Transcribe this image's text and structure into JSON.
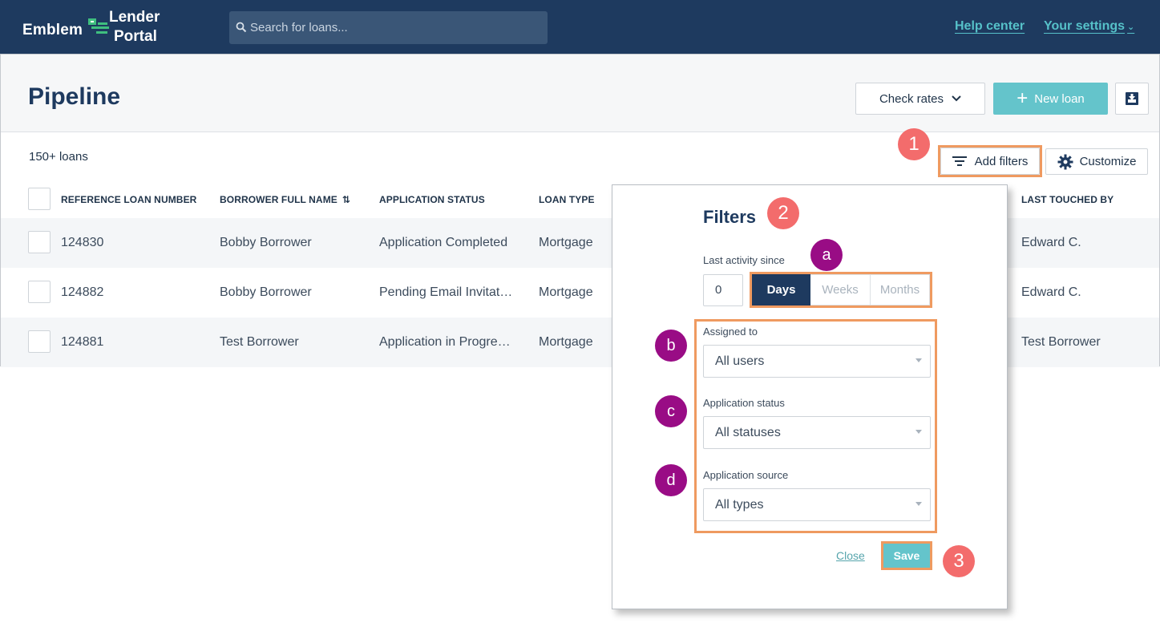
{
  "app": {
    "logo_word": "Emblem",
    "logo_line1": "Lender",
    "logo_line2": "Portal",
    "search_placeholder": "Search for loans...",
    "help_link": "Help center",
    "settings_link": "Your settings"
  },
  "page": {
    "title": "Pipeline",
    "check_rates_label": "Check rates",
    "new_loan_label": "New loan",
    "loan_count": "150+ loans",
    "add_filters_label": "Add filters",
    "customize_label": "Customize"
  },
  "table": {
    "headers": {
      "ref": "REFERENCE LOAN NUMBER",
      "borrower": "BORROWER FULL NAME",
      "status": "APPLICATION STATUS",
      "type": "LOAN TYPE",
      "touched": "LAST TOUCHED BY"
    },
    "rows": [
      {
        "ref": "124830",
        "borrower": "Bobby Borrower",
        "status": "Application Completed",
        "type": "Mortgage",
        "touched": "Edward C."
      },
      {
        "ref": "124882",
        "borrower": "Bobby Borrower",
        "status": "Pending Email Invitat…",
        "type": "Mortgage",
        "touched": "Edward C."
      },
      {
        "ref": "124881",
        "borrower": "Test Borrower",
        "status": "Application in Progre…",
        "type": "Mortgage",
        "touched": "Test Borrower"
      }
    ]
  },
  "filters": {
    "title": "Filters",
    "last_activity_label": "Last activity since",
    "last_activity_value": "0",
    "units": [
      "Days",
      "Weeks",
      "Months"
    ],
    "selected_unit": "Days",
    "assigned_label": "Assigned to",
    "assigned_value": "All users",
    "status_label": "Application status",
    "status_value": "All statuses",
    "source_label": "Application source",
    "source_value": "All types",
    "close_label": "Close",
    "save_label": "Save"
  },
  "callouts": {
    "one": "1",
    "two": "2",
    "three": "3",
    "a": "a",
    "b": "b",
    "c": "c",
    "d": "d"
  },
  "colors": {
    "navy": "#1e3a5f",
    "teal": "#64c4cb",
    "highlight": "#ef9a60",
    "callout_number": "#f36c6c",
    "callout_letter": "#990c85"
  }
}
